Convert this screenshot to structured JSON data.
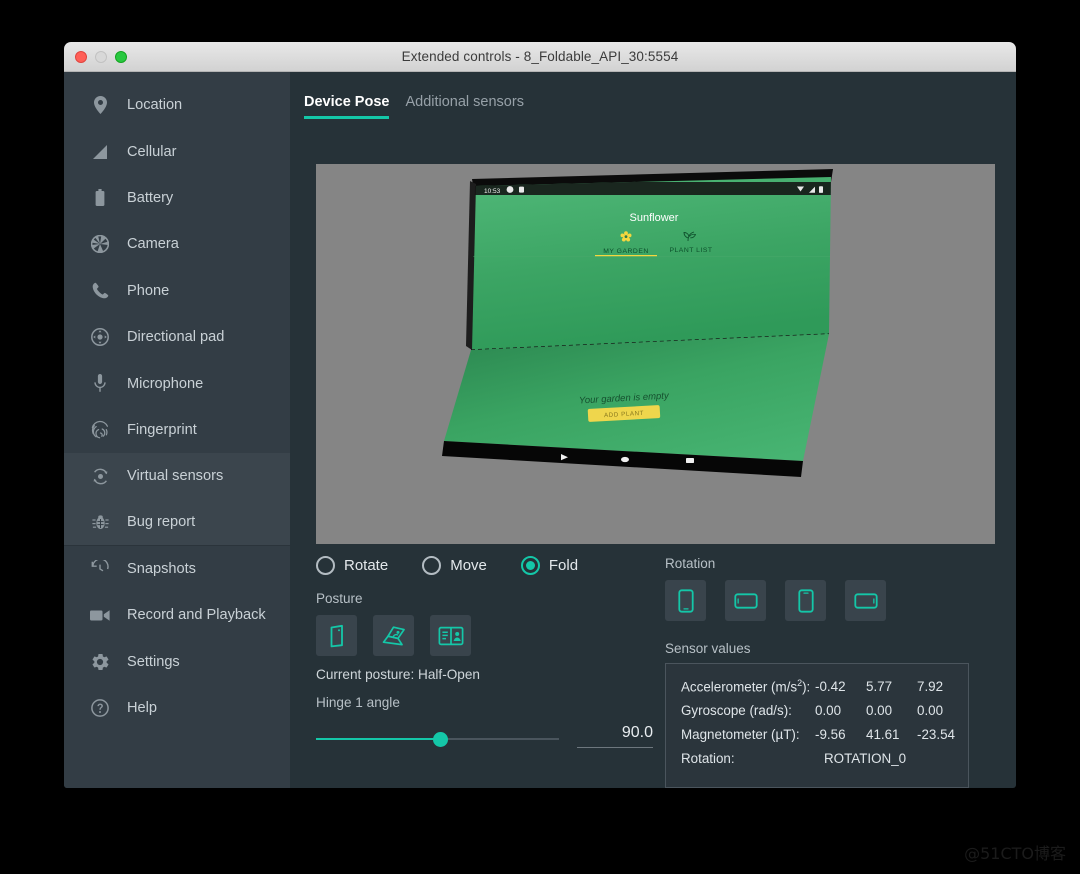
{
  "window": {
    "title": "Extended controls - 8_Foldable_API_30:5554",
    "traffic_lights": [
      "close",
      "minimize",
      "zoom"
    ]
  },
  "sidebar": {
    "items": [
      {
        "label": "Location",
        "icon": "location-pin-icon",
        "selected": false
      },
      {
        "label": "Cellular",
        "icon": "cellular-signal-icon",
        "selected": false
      },
      {
        "label": "Battery",
        "icon": "battery-icon",
        "selected": false
      },
      {
        "label": "Camera",
        "icon": "camera-aperture-icon",
        "selected": false
      },
      {
        "label": "Phone",
        "icon": "phone-handset-icon",
        "selected": false
      },
      {
        "label": "Directional pad",
        "icon": "dpad-icon",
        "selected": false
      },
      {
        "label": "Microphone",
        "icon": "microphone-icon",
        "selected": false
      },
      {
        "label": "Fingerprint",
        "icon": "fingerprint-icon",
        "selected": false
      },
      {
        "label": "Virtual sensors",
        "icon": "virtual-sensors-icon",
        "selected": true
      },
      {
        "label": "Bug report",
        "icon": "bug-icon",
        "selected": true
      },
      {
        "label": "Snapshots",
        "icon": "history-clock-icon",
        "selected": false
      },
      {
        "label": "Record and Playback",
        "icon": "video-camera-icon",
        "selected": false
      },
      {
        "label": "Settings",
        "icon": "gear-icon",
        "selected": false
      },
      {
        "label": "Help",
        "icon": "help-circle-icon",
        "selected": false
      }
    ]
  },
  "main": {
    "tabs": [
      {
        "label": "Device Pose",
        "active": true
      },
      {
        "label": "Additional sensors",
        "active": false
      }
    ],
    "preview": {
      "background_color": "#858585",
      "device": {
        "app_title": "Sunflower",
        "status_bar_time": "10:53",
        "tabs": [
          "MY GARDEN",
          "PLANT LIST"
        ],
        "empty_text": "Your garden is empty",
        "empty_button": "ADD PLANT",
        "screen_color": "#3a9e60",
        "accent_color": "#f6d84a"
      }
    },
    "pose_modes": [
      {
        "label": "Rotate",
        "selected": false
      },
      {
        "label": "Move",
        "selected": false
      },
      {
        "label": "Fold",
        "selected": true
      }
    ],
    "posture": {
      "label": "Posture",
      "options": [
        {
          "name": "closed-posture",
          "selected": false
        },
        {
          "name": "half-open-posture",
          "selected": false
        },
        {
          "name": "open-posture",
          "selected": false
        }
      ],
      "current_text": "Current posture:",
      "current_value": "Half-Open"
    },
    "hinge": {
      "label": "Hinge 1 angle",
      "value": "90.0",
      "fill_percent": 51
    },
    "rotation": {
      "label": "Rotation",
      "options": [
        {
          "name": "portrait-rotation"
        },
        {
          "name": "landscape-rotation"
        },
        {
          "name": "reverse-portrait-rotation"
        },
        {
          "name": "reverse-landscape-rotation"
        }
      ]
    },
    "sensor_values": {
      "label": "Sensor values",
      "rows": [
        {
          "name": "Accelerometer (m/s",
          "sup": "2",
          "name_tail": "):",
          "values": [
            "-0.42",
            "5.77",
            "7.92"
          ]
        },
        {
          "name": "Gyroscope (rad/s):",
          "sup": "",
          "name_tail": "",
          "values": [
            "0.00",
            "0.00",
            "0.00"
          ]
        },
        {
          "name": "Magnetometer (µT):",
          "sup": "",
          "name_tail": "",
          "values": [
            "-9.56",
            "41.61",
            "-23.54"
          ]
        },
        {
          "name": "Rotation:",
          "sup": "",
          "name_tail": "",
          "values": [
            "ROTATION_0"
          ]
        }
      ]
    }
  },
  "watermark": "@51CTO博客",
  "colors": {
    "accent_teal": "#14c7a8",
    "sidebar_bg": "#333d45",
    "main_bg": "#263238",
    "panel_bg": "#2b353c"
  }
}
